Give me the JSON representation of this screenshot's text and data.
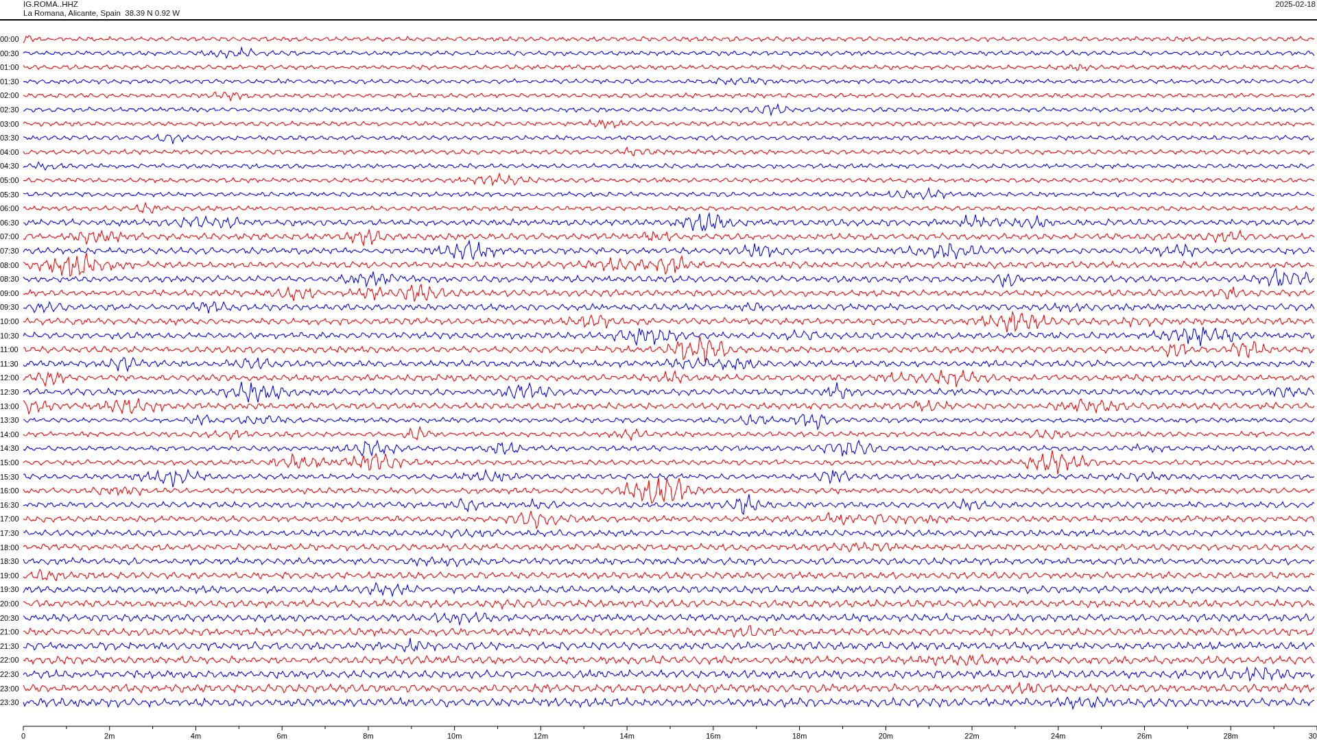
{
  "header": {
    "station": "IG.ROMA..HHZ",
    "location": "La Romana, Alicante, Spain  38.39 N 0.92 W",
    "date": "2025-02-18"
  },
  "traces": [
    {
      "label": "00:00",
      "color": "#ff0000"
    },
    {
      "label": "00:30",
      "color": "#0000ff"
    },
    {
      "label": "01:00",
      "color": "#ff0000"
    },
    {
      "label": "01:30",
      "color": "#0000ff"
    },
    {
      "label": "02:00",
      "color": "#ff0000"
    },
    {
      "label": "02:30",
      "color": "#0000ff"
    },
    {
      "label": "03:00",
      "color": "#ff0000"
    },
    {
      "label": "03:30",
      "color": "#0000ff"
    },
    {
      "label": "04:00",
      "color": "#ff0000"
    },
    {
      "label": "04:30",
      "color": "#0000ff"
    },
    {
      "label": "05:00",
      "color": "#ff0000"
    },
    {
      "label": "05:30",
      "color": "#0000ff"
    },
    {
      "label": "06:00",
      "color": "#ff0000"
    },
    {
      "label": "06:30",
      "color": "#0000ff"
    },
    {
      "label": "07:00",
      "color": "#ff0000"
    },
    {
      "label": "07:30",
      "color": "#0000ff"
    },
    {
      "label": "08:00",
      "color": "#ff0000"
    },
    {
      "label": "08:30",
      "color": "#0000ff"
    },
    {
      "label": "09:00",
      "color": "#ff0000"
    },
    {
      "label": "09:30",
      "color": "#0000ff"
    },
    {
      "label": "10:00",
      "color": "#ff0000"
    },
    {
      "label": "10:30",
      "color": "#0000ff"
    },
    {
      "label": "11:00",
      "color": "#ff0000"
    },
    {
      "label": "11:30",
      "color": "#0000ff"
    },
    {
      "label": "12:00",
      "color": "#ff0000"
    },
    {
      "label": "12:30",
      "color": "#0000ff"
    },
    {
      "label": "13:00",
      "color": "#ff0000"
    },
    {
      "label": "13:30",
      "color": "#0000ff"
    },
    {
      "label": "14:00",
      "color": "#ff0000"
    },
    {
      "label": "14:30",
      "color": "#0000ff"
    },
    {
      "label": "15:00",
      "color": "#ff0000"
    },
    {
      "label": "15:30",
      "color": "#0000ff"
    },
    {
      "label": "16:00",
      "color": "#ff0000"
    },
    {
      "label": "16:30",
      "color": "#0000ff"
    },
    {
      "label": "17:00",
      "color": "#ff0000"
    },
    {
      "label": "17:30",
      "color": "#0000ff"
    },
    {
      "label": "18:00",
      "color": "#ff0000"
    },
    {
      "label": "18:30",
      "color": "#0000ff"
    },
    {
      "label": "19:00",
      "color": "#ff0000"
    },
    {
      "label": "19:30",
      "color": "#0000ff"
    },
    {
      "label": "20:00",
      "color": "#ff0000"
    },
    {
      "label": "20:30",
      "color": "#0000ff"
    },
    {
      "label": "21:00",
      "color": "#ff0000"
    },
    {
      "label": "21:30",
      "color": "#0000ff"
    },
    {
      "label": "22:00",
      "color": "#ff0000"
    },
    {
      "label": "22:30",
      "color": "#0000ff"
    },
    {
      "label": "23:00",
      "color": "#ff0000"
    },
    {
      "label": "23:30",
      "color": "#0000ff"
    }
  ],
  "axis": {
    "ticks": [
      "0",
      "2m",
      "4m",
      "6m",
      "8m",
      "10m",
      "12m",
      "14m",
      "16m",
      "18m",
      "20m",
      "22m",
      "24m",
      "26m",
      "28m",
      "30"
    ]
  }
}
